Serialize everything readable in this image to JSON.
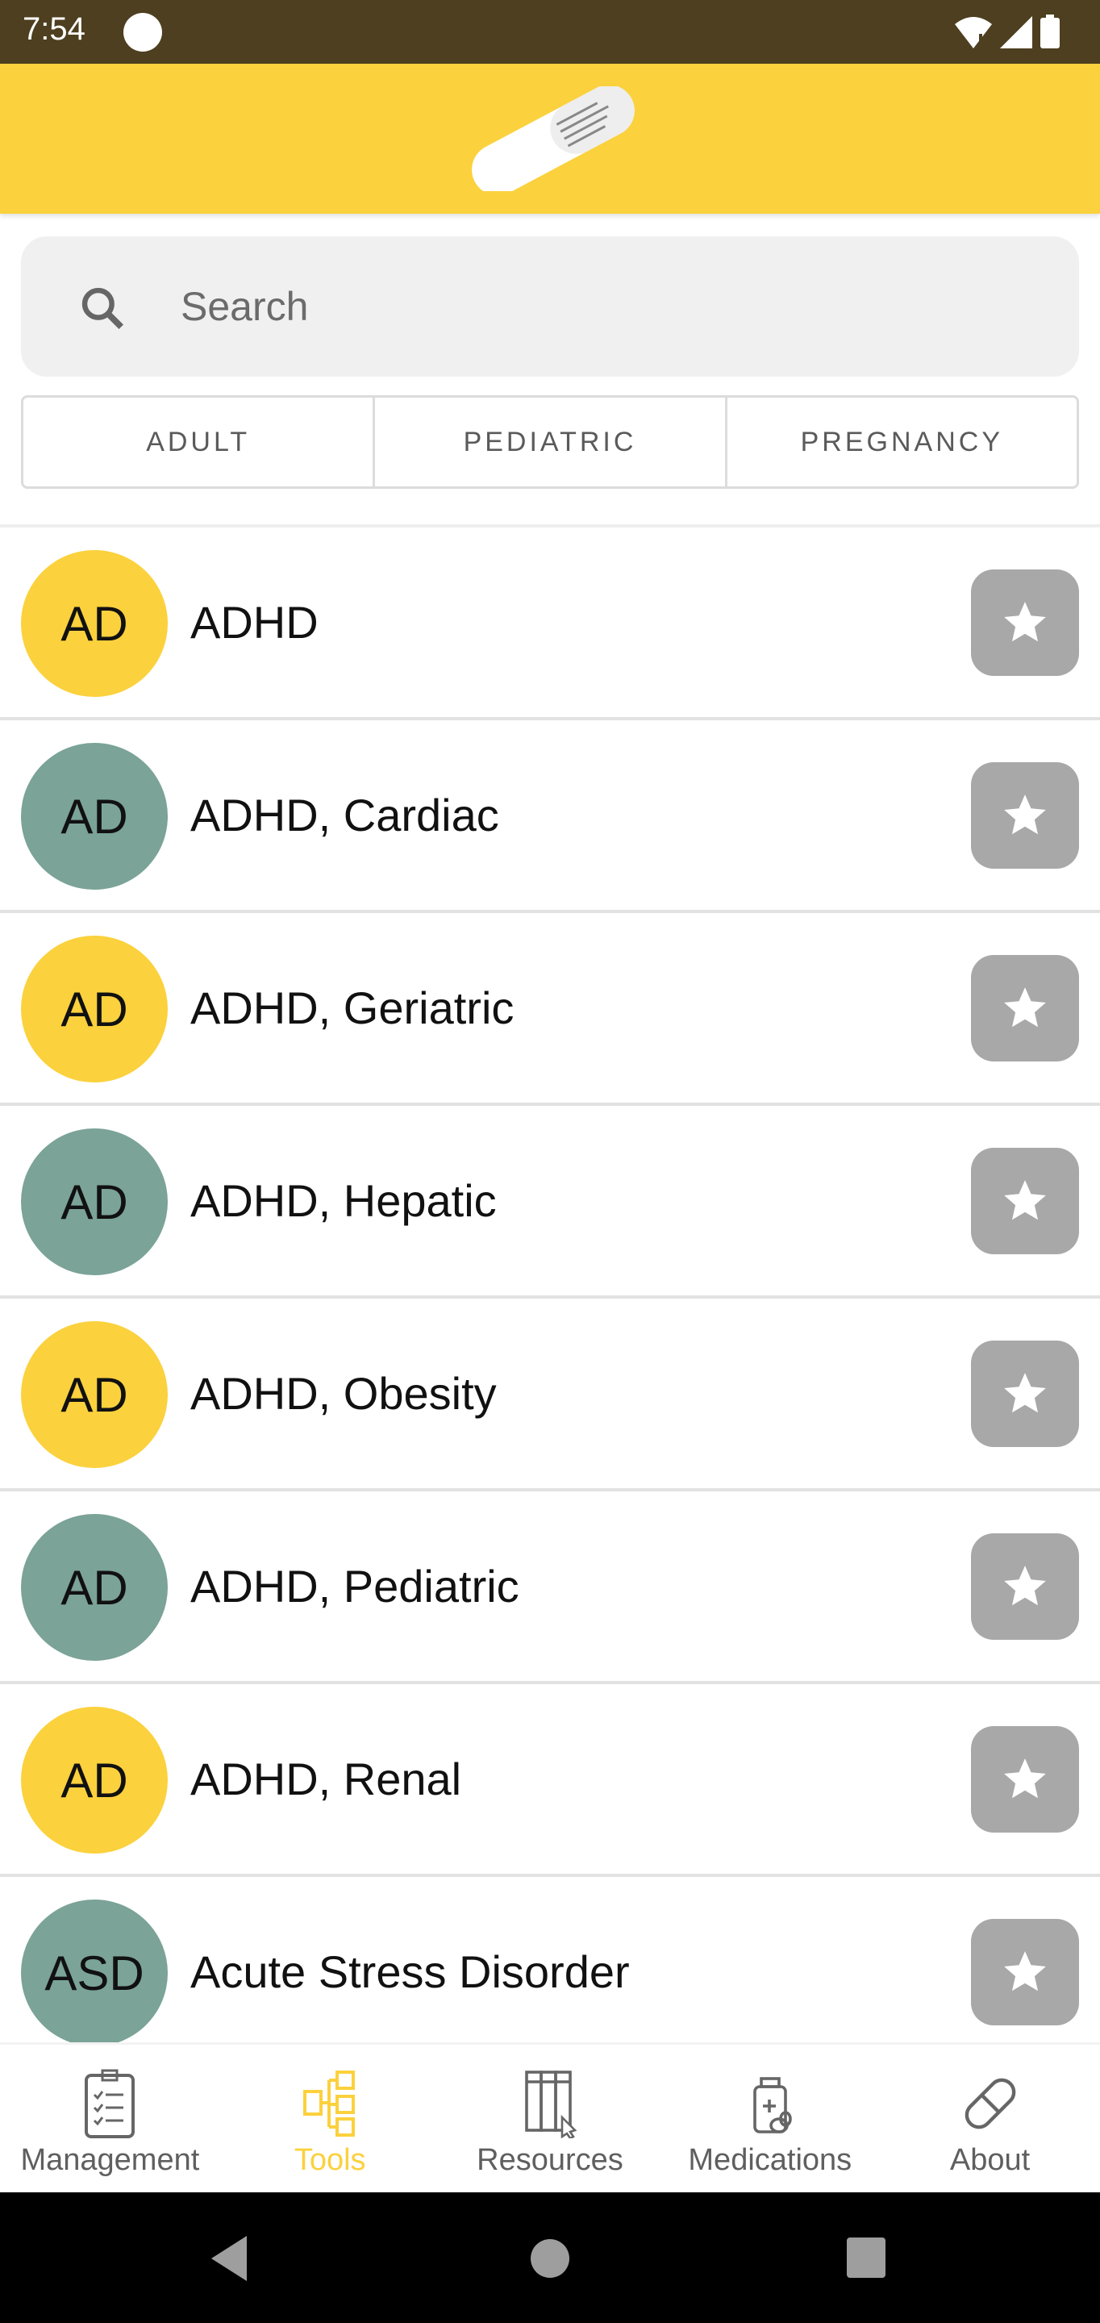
{
  "status_bar": {
    "time": "7:54"
  },
  "header": {
    "logo": "pill-capsule-logo"
  },
  "search": {
    "placeholder": "Search",
    "value": ""
  },
  "segments": [
    {
      "label": "ADULT"
    },
    {
      "label": "PEDIATRIC"
    },
    {
      "label": "PREGNANCY"
    }
  ],
  "colors": {
    "yellow": "#fbd13d",
    "teal": "#7ba398",
    "star_bg": "#a8a8a8",
    "status_bar": "#4d3f1f"
  },
  "list": [
    {
      "initials": "AD",
      "label": "ADHD",
      "color": "#fbd13d",
      "favorite": false
    },
    {
      "initials": "AD",
      "label": "ADHD, Cardiac",
      "color": "#7ba398",
      "favorite": false
    },
    {
      "initials": "AD",
      "label": "ADHD, Geriatric",
      "color": "#fbd13d",
      "favorite": false
    },
    {
      "initials": "AD",
      "label": "ADHD, Hepatic",
      "color": "#7ba398",
      "favorite": false
    },
    {
      "initials": "AD",
      "label": "ADHD, Obesity",
      "color": "#fbd13d",
      "favorite": false
    },
    {
      "initials": "AD",
      "label": "ADHD, Pediatric",
      "color": "#7ba398",
      "favorite": false
    },
    {
      "initials": "AD",
      "label": "ADHD, Renal",
      "color": "#fbd13d",
      "favorite": false
    },
    {
      "initials": "ASD",
      "label": "Acute Stress Disorder",
      "color": "#7ba398",
      "favorite": false
    }
  ],
  "bottom_nav": [
    {
      "label": "Management",
      "icon": "clipboard-checklist-icon",
      "active": false
    },
    {
      "label": "Tools",
      "icon": "flowchart-icon",
      "active": true
    },
    {
      "label": "Resources",
      "icon": "books-icon",
      "active": false
    },
    {
      "label": "Medications",
      "icon": "medicine-bottle-icon",
      "active": false
    },
    {
      "label": "About",
      "icon": "pill-icon",
      "active": false
    }
  ]
}
